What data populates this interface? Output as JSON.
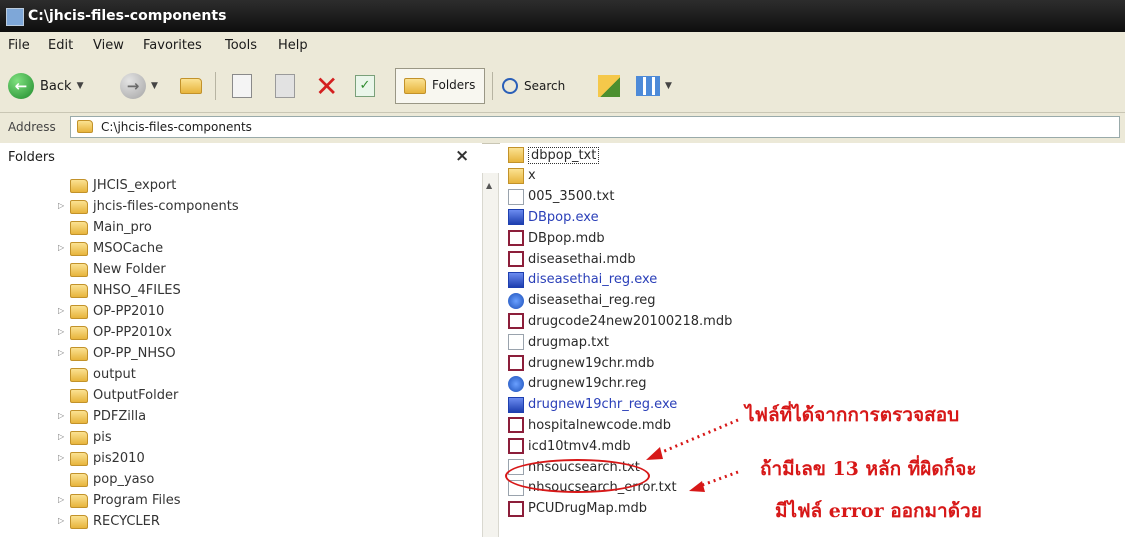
{
  "window": {
    "title": "C:\\jhcis-files-components"
  },
  "menu": [
    "File",
    "Edit",
    "View",
    "Favorites",
    "Tools",
    "Help"
  ],
  "toolbar": {
    "back": "Back",
    "folders": "Folders",
    "search": "Search"
  },
  "address": {
    "label": "Address",
    "value": "C:\\jhcis-files-components"
  },
  "folders_pane": {
    "title": "Folders",
    "close": "×",
    "items": [
      {
        "label": "JHCIS_export",
        "expandable": false
      },
      {
        "label": "jhcis-files-components",
        "expandable": true
      },
      {
        "label": "Main_pro",
        "expandable": false
      },
      {
        "label": "MSOCache",
        "expandable": true
      },
      {
        "label": "New Folder",
        "expandable": false
      },
      {
        "label": "NHSO_4FILES",
        "expandable": false
      },
      {
        "label": "OP-PP2010",
        "expandable": true
      },
      {
        "label": "OP-PP2010x",
        "expandable": true
      },
      {
        "label": "OP-PP_NHSO",
        "expandable": true
      },
      {
        "label": "output",
        "expandable": false
      },
      {
        "label": "OutputFolder",
        "expandable": false
      },
      {
        "label": "PDFZilla",
        "expandable": true
      },
      {
        "label": "pis",
        "expandable": true
      },
      {
        "label": "pis2010",
        "expandable": true
      },
      {
        "label": "pop_yaso",
        "expandable": false
      },
      {
        "label": "Program Files",
        "expandable": true
      },
      {
        "label": "RECYCLER",
        "expandable": true
      }
    ]
  },
  "files": [
    {
      "name": "dbpop_txt",
      "icon": "folder"
    },
    {
      "name": "x",
      "icon": "folder"
    },
    {
      "name": "005_3500.txt",
      "icon": "txt"
    },
    {
      "name": "DBpop.exe",
      "icon": "exe"
    },
    {
      "name": "DBpop.mdb",
      "icon": "mdb"
    },
    {
      "name": "diseasethai.mdb",
      "icon": "mdb"
    },
    {
      "name": "diseasethai_reg.exe",
      "icon": "exe"
    },
    {
      "name": "diseasethai_reg.reg",
      "icon": "reg"
    },
    {
      "name": "drugcode24new20100218.mdb",
      "icon": "mdb"
    },
    {
      "name": "drugmap.txt",
      "icon": "txt"
    },
    {
      "name": "drugnew19chr.mdb",
      "icon": "mdb"
    },
    {
      "name": "drugnew19chr.reg",
      "icon": "reg"
    },
    {
      "name": "drugnew19chr_reg.exe",
      "icon": "exe"
    },
    {
      "name": "hospitalnewcode.mdb",
      "icon": "mdb"
    },
    {
      "name": "icd10tmv4.mdb",
      "icon": "mdb"
    },
    {
      "name": "nhsoucsearch.txt",
      "icon": "txt"
    },
    {
      "name": "nhsoucsearch_error.txt",
      "icon": "txt"
    },
    {
      "name": "PCUDrugMap.mdb",
      "icon": "mdb"
    }
  ],
  "annotations": {
    "line1": "ไฟล์ที่ได้จากการตรวจสอบ",
    "line2": "ถ้ามีเลข 13 หลัก ที่ผิดก็จะ",
    "line3": "มีไฟล์ error ออกมาด้วย"
  }
}
